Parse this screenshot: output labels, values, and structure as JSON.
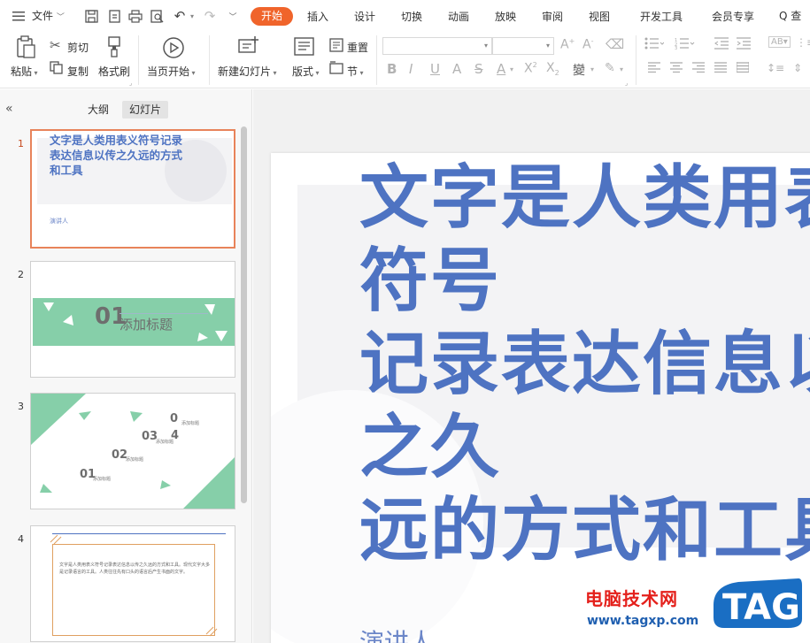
{
  "menubar": {
    "file_label": "文件",
    "tabs": [
      "开始",
      "插入",
      "设计",
      "切换",
      "动画",
      "放映",
      "审阅",
      "视图",
      "开发工具",
      "会员专享"
    ],
    "search_label": "Q 查"
  },
  "ribbon": {
    "paste_label": "粘贴",
    "cut_label": "剪切",
    "copy_label": "复制",
    "format_painter_label": "格式刷",
    "from_current_label": "当页开始",
    "new_slide_label": "新建幻灯片",
    "layout_label": "版式",
    "reset_label": "重置",
    "section_label": "节",
    "font_name_value": "",
    "font_size_value": ""
  },
  "panel": {
    "tab_outline": "大纲",
    "tab_slides": "幻灯片",
    "slides": [
      {
        "number": "1",
        "title": "文字是人类用表义符号记录表达信息以传之久远的方式和工具",
        "presenter": "演讲人"
      },
      {
        "number": "2",
        "num_text": "01",
        "title": "添加标题"
      },
      {
        "number": "3",
        "items": [
          "0",
          "4",
          "03",
          "02",
          "01"
        ],
        "labels": [
          "添加标题",
          "添加标题",
          "添加标题",
          "添加标题"
        ]
      },
      {
        "number": "4",
        "body": "文字是人类用表义符号记录表达信息以传之久远的方式和工具。现代文字大多是记录语言的工具。人类往往先有口头的语言后产生书面的文字。"
      }
    ]
  },
  "slide": {
    "title_lines": [
      "文字是人类用表义符号",
      "记录表达信息以传之久",
      "远的方式和工具"
    ],
    "presenter": "演讲人"
  },
  "watermark": {
    "text": "电脑技术网",
    "url": "www.tagxp.com",
    "logo": "TAG"
  },
  "colors": {
    "accent_tab": "#f0642b",
    "title_blue": "#4e73c2",
    "thumb_green": "#86cfa9",
    "active_border": "#e8835a"
  }
}
